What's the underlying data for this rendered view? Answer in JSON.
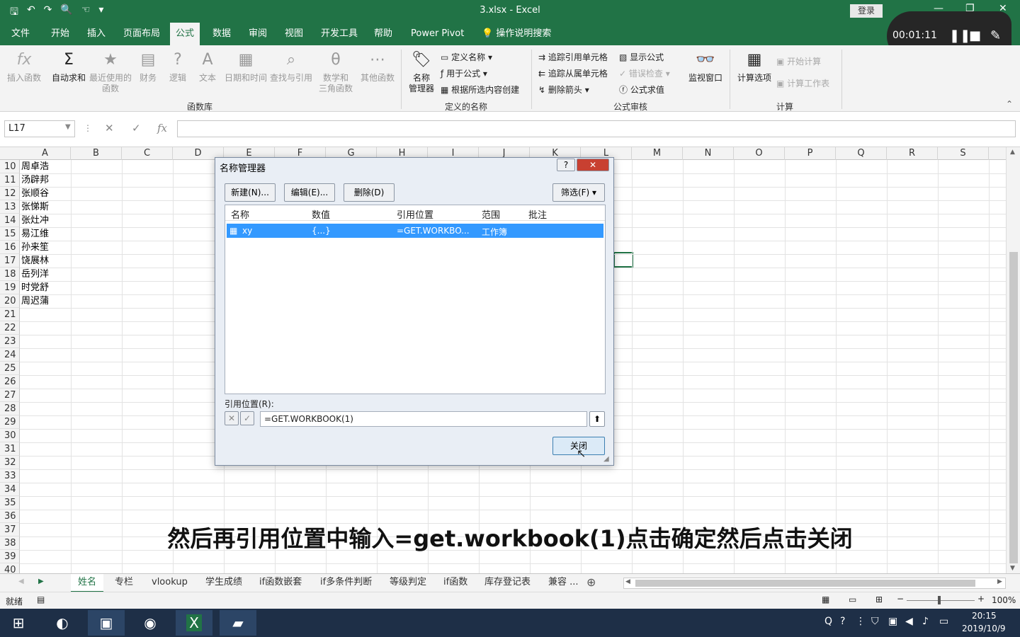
{
  "window": {
    "title": "3.xlsx  -  Excel",
    "login": "登录"
  },
  "tabs": [
    "文件",
    "开始",
    "插入",
    "页面布局",
    "公式",
    "数据",
    "审阅",
    "视图",
    "开发工具",
    "帮助",
    "Power Pivot"
  ],
  "active_tab": "公式",
  "tell_me": "操作说明搜索",
  "recorder": {
    "time": "00:01:11"
  },
  "ribbon": {
    "insert_function": "插入函数",
    "autosum": "自动求和",
    "recent": "最近使用的\n函数",
    "financial": "财务",
    "logical": "逻辑",
    "text": "文本",
    "datetime": "日期和时间",
    "lookup": "查找与引用",
    "math": "数学和\n三角函数",
    "other": "其他函数",
    "library_group": "函数库",
    "name_manager": "名称\n管理器",
    "define_name": "定义名称",
    "use_in_formula": "用于公式",
    "create_from_selection": "根据所选内容创建",
    "names_group": "定义的名称",
    "trace_precedents": "追踪引用单元格",
    "trace_dependents": "追踪从属单元格",
    "remove_arrows": "删除箭头",
    "show_formulas": "显示公式",
    "error_checking": "错误检查",
    "evaluate_formula": "公式求值",
    "watch_window": "监视窗口",
    "audit_group": "公式审核",
    "calc_options": "计算选项",
    "calc_now": "开始计算",
    "calc_sheet": "计算工作表",
    "calc_group": "计算"
  },
  "formula_bar": {
    "namebox": "L17",
    "fx": "fx",
    "content": ""
  },
  "columns": [
    "A",
    "B",
    "C",
    "D",
    "E",
    "F",
    "G",
    "H",
    "I",
    "J",
    "K",
    "L",
    "M",
    "N",
    "O",
    "P",
    "Q",
    "R",
    "S"
  ],
  "rows": [
    "10",
    "11",
    "12",
    "13",
    "14",
    "15",
    "16",
    "17",
    "18",
    "19",
    "20",
    "21",
    "22",
    "23",
    "24",
    "25",
    "26",
    "27",
    "28",
    "29",
    "30",
    "31",
    "32",
    "33",
    "34",
    "35",
    "36",
    "37",
    "38",
    "39",
    "40"
  ],
  "cells_a": [
    "周卓浩",
    "汤辟邦",
    "张顺谷",
    "张悌斯",
    "张灶冲",
    "易江维",
    "孙来笙",
    "饶展林",
    "岳列洋",
    "时党舒",
    "周迟蒲"
  ],
  "sheets": [
    "姓名",
    "专栏",
    "vlookup",
    "学生成绩",
    "if函数嵌套",
    "if多条件判断",
    "等级判定",
    "if函数",
    "库存登记表",
    "兼容 ..."
  ],
  "active_sheet": "姓名",
  "status": {
    "ready": "就绪",
    "zoom": "100%"
  },
  "dialog": {
    "title": "名称管理器",
    "new": "新建(N)...",
    "edit": "编辑(E)...",
    "delete": "删除(D)",
    "filter": "筛选(F) ▾",
    "headers": [
      "名称",
      "数值",
      "引用位置",
      "范围",
      "批注"
    ],
    "row": {
      "name": "xy",
      "value": "{...}",
      "ref": "=GET.WORKBO...",
      "scope": "工作簿",
      "note": ""
    },
    "ref_label": "引用位置(R):",
    "ref_value": "=GET.WORKBOOK(1)",
    "close": "关闭"
  },
  "subtitle": "然后再引用位置中输入=get.workbook(1)点击确定然后点击关闭",
  "clock": {
    "time": "20:15",
    "date": "2019/10/9"
  }
}
